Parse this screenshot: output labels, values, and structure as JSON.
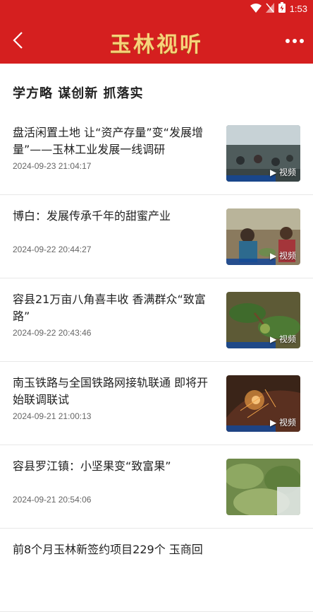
{
  "status": {
    "time": "1:53"
  },
  "app": {
    "brand": "玉林视听",
    "accent": "#d51f1f",
    "brand_color": "#f6d27a"
  },
  "section": {
    "title": "学方略 谋创新 抓落实"
  },
  "video_badge": "▶ 视频",
  "items": [
    {
      "title": "盘活闲置土地 让“资产存量”变“发展增量”——玉林工业发展一线调研",
      "date": "2024-09-23 21:04:17"
    },
    {
      "title": "博白：发展传承千年的甜蜜产业",
      "date": "2024-09-22 20:44:27"
    },
    {
      "title": "容县21万亩八角喜丰收 香满群众“致富路”",
      "date": "2024-09-22 20:43:46"
    },
    {
      "title": "南玉铁路与全国铁路网接轨联通 即将开始联调联试",
      "date": "2024-09-21 21:00:13"
    },
    {
      "title": "容县罗江镇：小坚果变“致富果”",
      "date": "2024-09-21 20:54:06"
    },
    {
      "title": "前8个月玉林新签约项目229个 玉商回",
      "date": ""
    }
  ]
}
